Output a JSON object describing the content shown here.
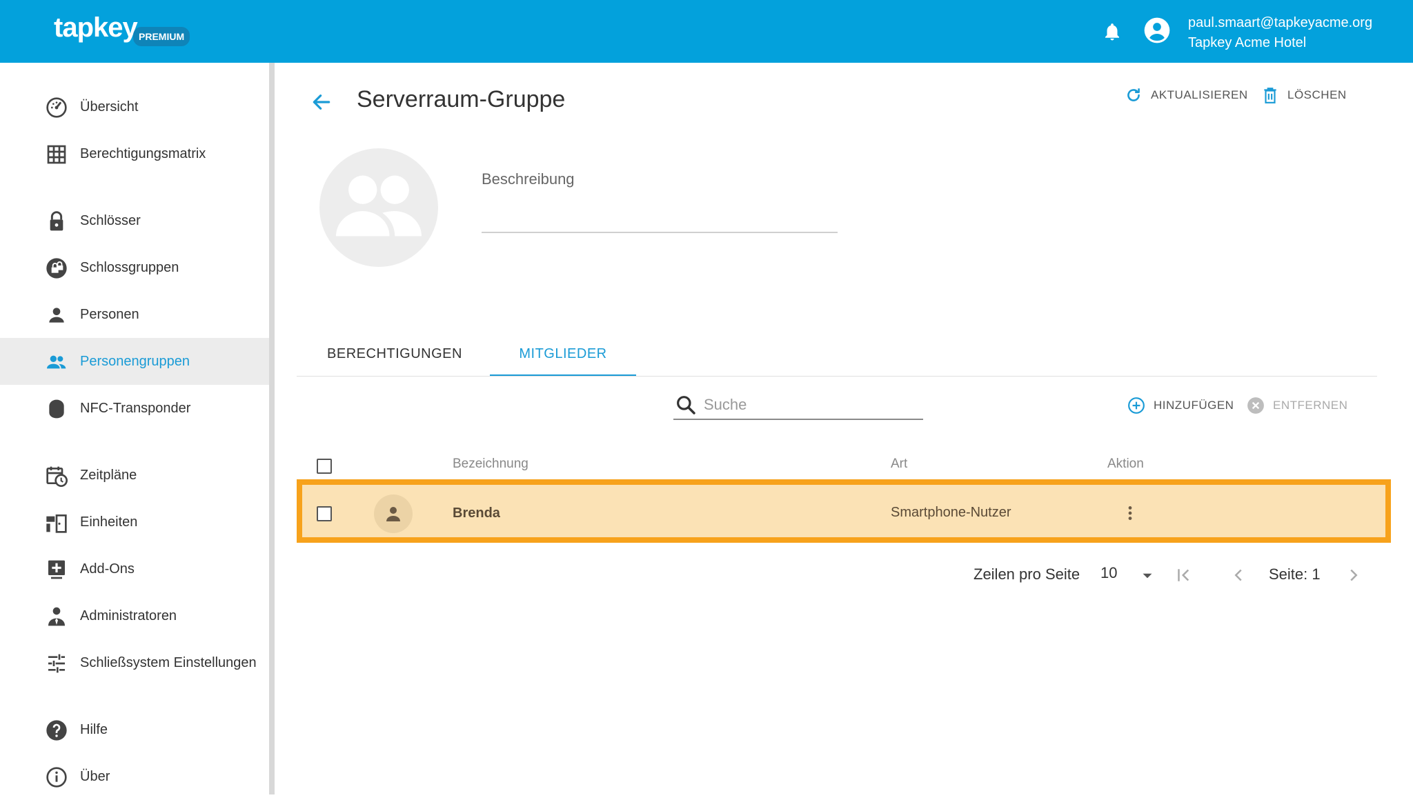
{
  "header": {
    "logo": "tapkey",
    "badge": "PREMIUM",
    "user_email": "paul.smaart@tapkeyacme.org",
    "user_org": "Tapkey Acme Hotel"
  },
  "sidebar": {
    "items": [
      {
        "label": "Übersicht",
        "icon": "dashboard-icon"
      },
      {
        "label": "Berechtigungsmatrix",
        "icon": "grid-icon"
      },
      {
        "label": "Schlösser",
        "icon": "lock-icon"
      },
      {
        "label": "Schlossgruppen",
        "icon": "lock-group-icon"
      },
      {
        "label": "Personen",
        "icon": "person-icon"
      },
      {
        "label": "Personengruppen",
        "icon": "people-icon",
        "active": true
      },
      {
        "label": "NFC-Transponder",
        "icon": "transponder-icon"
      },
      {
        "label": "Zeitpläne",
        "icon": "calendar-clock-icon"
      },
      {
        "label": "Einheiten",
        "icon": "unit-icon"
      },
      {
        "label": "Add-Ons",
        "icon": "add-on-icon"
      },
      {
        "label": "Administratoren",
        "icon": "admin-icon"
      },
      {
        "label": "Schließsystem Einstellungen",
        "icon": "tune-icon"
      },
      {
        "label": "Hilfe",
        "icon": "help-icon"
      },
      {
        "label": "Über",
        "icon": "info-icon"
      }
    ]
  },
  "page": {
    "title": "Serverraum-Gruppe",
    "refresh_label": "AKTUALISIEREN",
    "delete_label": "LÖSCHEN",
    "description_label": "Beschreibung",
    "description_value": ""
  },
  "tabs": {
    "permissions": "BERECHTIGUNGEN",
    "members": "MITGLIEDER",
    "active": "members"
  },
  "members": {
    "search_placeholder": "Suche",
    "add_label": "HINZUFÜGEN",
    "remove_label": "ENTFERNEN",
    "columns": {
      "name": "Bezeichnung",
      "type": "Art",
      "action": "Aktion"
    },
    "rows": [
      {
        "name": "Brenda",
        "type": "Smartphone-Nutzer",
        "selected": false
      }
    ],
    "pager": {
      "rows_per_page_label": "Zeilen pro Seite",
      "rows_per_page": "10",
      "page_label": "Seite: 1"
    }
  },
  "colors": {
    "header": "#03a1dc",
    "accent": "#1a9bd6",
    "highlight_border": "#f7a21b",
    "highlight_fill": "#fbe2b5"
  }
}
